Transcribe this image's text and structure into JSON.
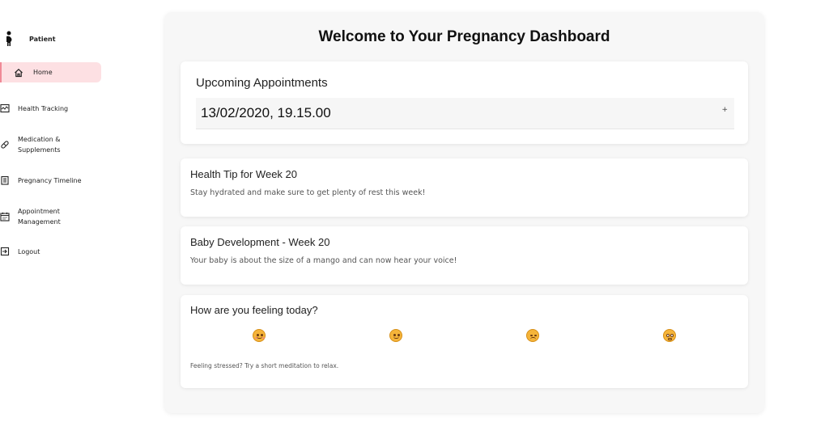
{
  "sidebar": {
    "profile_name": "Patient",
    "items": [
      {
        "label": "Home",
        "icon": "home-icon"
      },
      {
        "label": "Health Tracking",
        "icon": "chart-icon"
      },
      {
        "label": "Medication &\nSupplements",
        "icon": "pill-icon"
      },
      {
        "label": "Pregnancy Timeline",
        "icon": "timeline-icon"
      },
      {
        "label": "Appointment\nManagement",
        "icon": "calendar-icon"
      },
      {
        "label": "Logout",
        "icon": "logout-icon"
      }
    ]
  },
  "main": {
    "title": "Welcome to Your Pregnancy Dashboard",
    "appointments": {
      "heading": "Upcoming Appointments",
      "date": "13/02/2020, 19.15.00",
      "expand_label": "+"
    },
    "health_tip": {
      "heading": "Health Tip for Week 20",
      "text": "Stay hydrated and make sure to get plenty of rest this week!"
    },
    "baby_development": {
      "heading": "Baby Development - Week 20",
      "text": "Your baby is about the size of a mango and can now hear your voice!"
    },
    "mood": {
      "heading": "How are you feeling today?",
      "options": [
        "happy-emoji",
        "neutral-emoji",
        "sad-emoji",
        "anxious-emoji"
      ],
      "note": "Feeling stressed? Try a short meditation to relax."
    }
  },
  "colors": {
    "active_nav_bg": "#fde0e3",
    "active_nav_border": "#f08a97",
    "panel_bg": "#f7f7f7",
    "card_bg": "#ffffff"
  }
}
